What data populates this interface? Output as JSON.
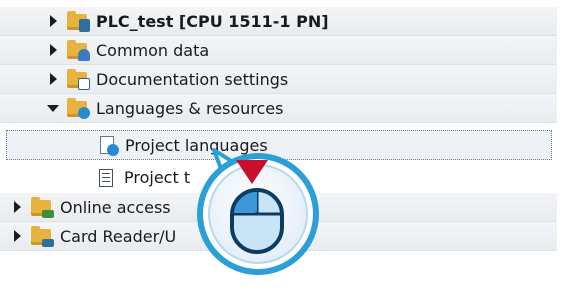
{
  "tree": {
    "items": [
      {
        "label": "PLC_test [CPU 1511-1 PN]",
        "expander": "collapsed",
        "icon": "plc-folder-icon",
        "bold": true
      },
      {
        "label": "Common data",
        "expander": "collapsed",
        "icon": "common-data-folder-icon"
      },
      {
        "label": "Documentation settings",
        "expander": "collapsed",
        "icon": "documentation-folder-icon"
      },
      {
        "label": "Languages & resources",
        "expander": "expanded",
        "icon": "languages-folder-icon"
      },
      {
        "label": "Project languages",
        "expander": "none",
        "icon": "project-languages-icon",
        "selected": true
      },
      {
        "label": "Project t",
        "expander": "none",
        "icon": "project-texts-icon"
      },
      {
        "label": "Online access",
        "expander": "collapsed",
        "icon": "online-access-folder-icon"
      },
      {
        "label": "Card Reader/U",
        "expander": "collapsed",
        "icon": "card-reader-folder-icon"
      }
    ]
  },
  "overlay": {
    "icon": "mouse-click-icon",
    "accent": "#c8102e",
    "ring": "#2a9fd8"
  }
}
